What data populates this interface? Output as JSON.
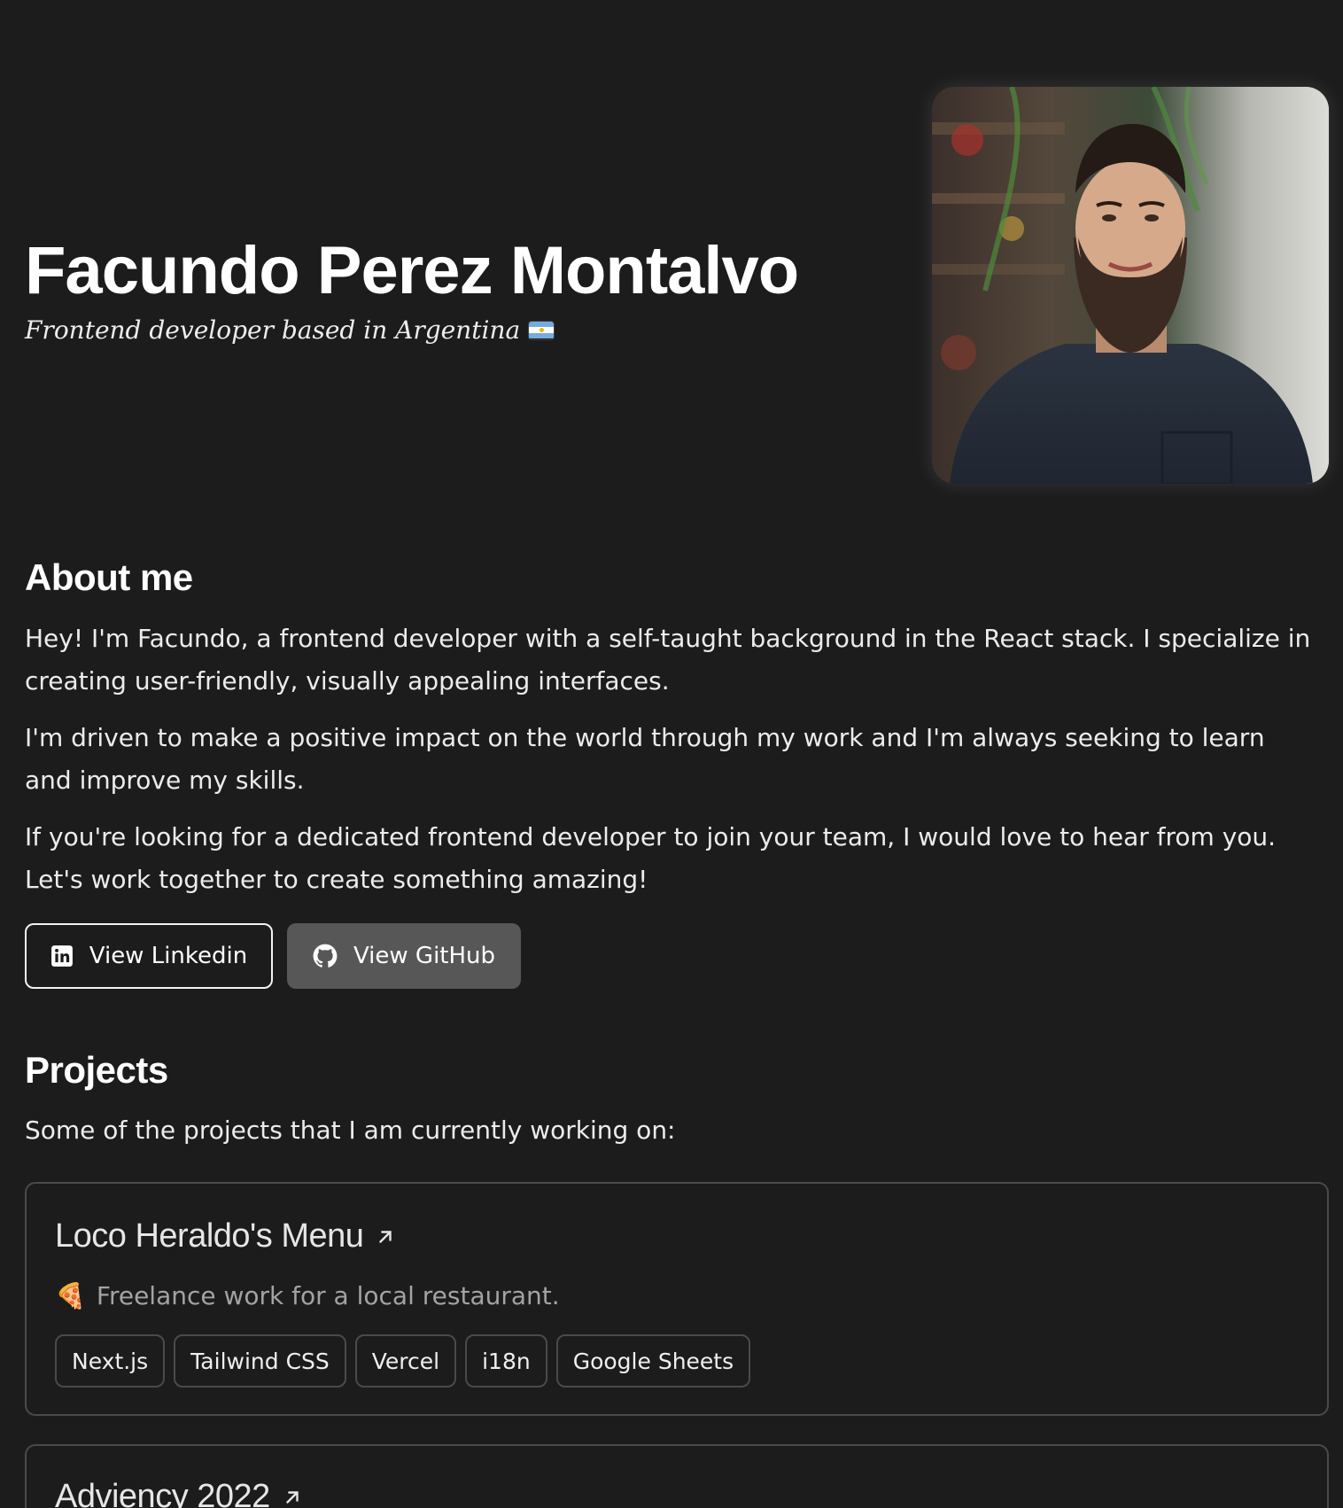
{
  "hero": {
    "name": "Facundo Perez Montalvo",
    "tagline": "Frontend developer based in Argentina",
    "flag_icon": "argentina-flag-icon",
    "flag_colors": [
      "#74acdf",
      "#ffffff",
      "#74acdf"
    ]
  },
  "about": {
    "title": "About me",
    "paragraphs": [
      "Hey! I'm Facundo, a frontend developer with a self-taught background in the React stack. I specialize in creating user-friendly, visually appealing interfaces.",
      "I'm driven to make a positive impact on the world through my work and I'm always seeking to learn and improve my skills.",
      "If you're looking for a dedicated frontend developer to join your team, I would love to hear from you. Let's work together to create something amazing!"
    ],
    "buttons": {
      "linkedin": "View Linkedin",
      "github": "View GitHub"
    }
  },
  "projects": {
    "title": "Projects",
    "intro": "Some of the projects that I am currently working on:",
    "items": [
      {
        "title": "Loco Heraldo's Menu",
        "emoji": "🍕",
        "description": "Freelance work for a local restaurant.",
        "tags": [
          "Next.js",
          "Tailwind CSS",
          "Vercel",
          "i18n",
          "Google Sheets"
        ]
      },
      {
        "title": "Adviency 2022"
      }
    ]
  },
  "colors": {
    "background": "#1c1c1c",
    "text": "#ececec",
    "muted": "#a3a3a3",
    "border": "#4a4a4a",
    "github_button": "#575757"
  }
}
